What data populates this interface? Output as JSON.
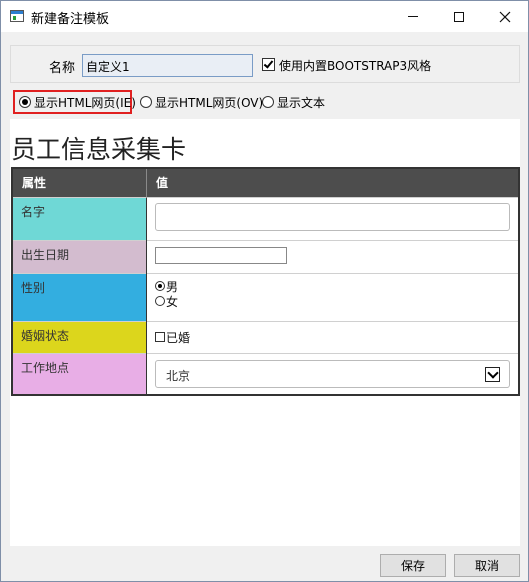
{
  "window": {
    "title": "新建备注模板"
  },
  "settings": {
    "name_label": "名称",
    "name_value": "自定义1",
    "bootstrap_checked": true,
    "bootstrap_label": "使用内置BOOTSTRAP3风格"
  },
  "display_modes": [
    {
      "label": "显示HTML网页(IE)",
      "selected": true
    },
    {
      "label": "显示HTML网页(OV)",
      "selected": false
    },
    {
      "label": "显示文本",
      "selected": false
    }
  ],
  "card": {
    "title": "员工信息采集卡",
    "headers": {
      "attr": "属性",
      "value": "值"
    },
    "rows": [
      {
        "label": "名字",
        "color": "#6fd8d6"
      },
      {
        "label": "出生日期",
        "color": "#d3bccf"
      },
      {
        "label": "性别",
        "color": "#33aee0",
        "options": [
          "男",
          "女"
        ],
        "selected": "男"
      },
      {
        "label": "婚姻状态",
        "color": "#dcd61c",
        "checkbox_label": "已婚",
        "checked": false
      },
      {
        "label": "工作地点",
        "color": "#e8aee6",
        "select_value": "北京"
      }
    ]
  },
  "footer": {
    "save_label": "保存",
    "cancel_label": "取消"
  },
  "colors": {
    "highlight_border": "#e02020",
    "table_header_bg": "#4d4d4d"
  }
}
